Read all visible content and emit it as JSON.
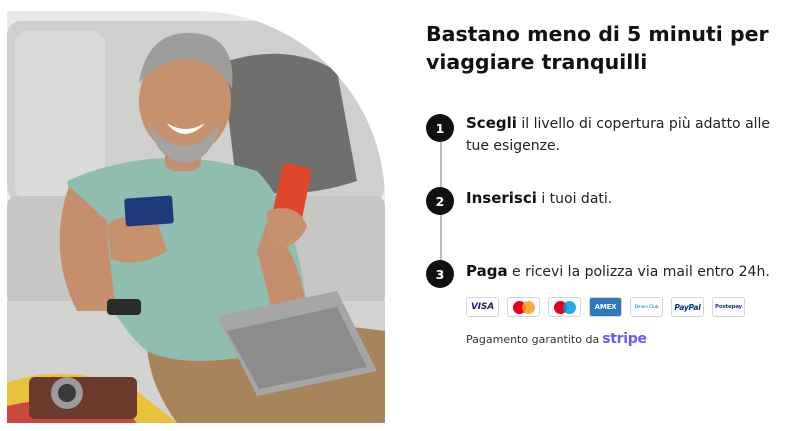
{
  "title": "Bastano meno di 5 minuti per viaggiare tranquilli",
  "steps": [
    {
      "number": "1",
      "strong": "Scegli",
      "rest": " il livello di copertura più adatto alle tue esigenze."
    },
    {
      "number": "2",
      "strong": "Inserisci",
      "rest": " i tuoi dati."
    },
    {
      "number": "3",
      "strong": "Paga",
      "rest": " e ricevi la polizza via mail entro 24h."
    }
  ],
  "payment_methods": [
    {
      "label": "VISA",
      "color": "#1a1f71"
    },
    {
      "label": "",
      "kind": "mastercard"
    },
    {
      "label": "",
      "kind": "maestro"
    },
    {
      "label": "AMEX",
      "color": "#2e77bb"
    },
    {
      "label": "Diners Club",
      "color": "#0079be"
    },
    {
      "label": "PayPal",
      "color": "#003087"
    },
    {
      "label": "Postepay",
      "color": "#1a3d8f"
    }
  ],
  "payment_note": "Pagamento garantito da",
  "payment_brand": "stripe",
  "colors": {
    "accent": "#111111",
    "stripe": "#635bff",
    "timeline": "#bdbdbd"
  }
}
